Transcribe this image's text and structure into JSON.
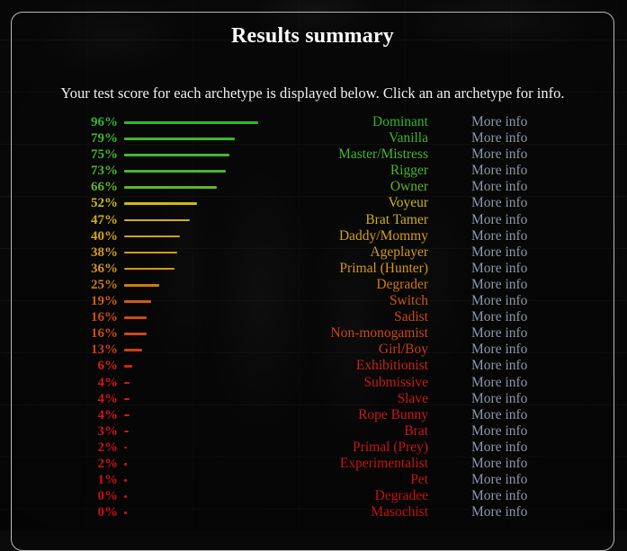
{
  "panel": {
    "title": "Results summary",
    "subtitle": "Your test score for each archetype is displayed below. Click an an archetype for info.",
    "more_info_label": "More info",
    "more_info_color": "#8d9aab",
    "border_color": "#b9b9b9",
    "title_color": "#ffffff"
  },
  "chart_data": {
    "type": "bar",
    "title": "Results summary",
    "xlabel": "",
    "ylabel": "",
    "xlim": [
      0,
      100
    ],
    "grid": false,
    "legend": null,
    "orientation": "horizontal",
    "value_suffix": "%",
    "categories": [
      "Dominant",
      "Vanilla",
      "Master/Mistress",
      "Rigger",
      "Owner",
      "Voyeur",
      "Brat Tamer",
      "Daddy/Mommy",
      "Ageplayer",
      "Primal (Hunter)",
      "Degrader",
      "Switch",
      "Sadist",
      "Non-monogamist",
      "Girl/Boy",
      "Exhibitionist",
      "Submissive",
      "Slave",
      "Rope Bunny",
      "Brat",
      "Primal (Prey)",
      "Experimentalist",
      "Pet",
      "Degradee",
      "Masochist"
    ],
    "values": [
      96,
      79,
      75,
      73,
      66,
      52,
      47,
      40,
      38,
      36,
      25,
      19,
      16,
      16,
      13,
      6,
      4,
      4,
      4,
      3,
      2,
      2,
      1,
      0,
      0
    ],
    "colors": [
      "#2db82d",
      "#3cb82a",
      "#46b828",
      "#4ab827",
      "#63b423",
      "#c9bb1c",
      "#cfb01a",
      "#d4a118",
      "#d59c17",
      "#d69817",
      "#cf7a14",
      "#ce5c16",
      "#cc4a16",
      "#cc4a16",
      "#cb3e16",
      "#cc2418",
      "#cc1a18",
      "#cc1a18",
      "#cc1a18",
      "#cc1818",
      "#cc1414",
      "#cc1414",
      "#cc1212",
      "#cc1010",
      "#cc1010"
    ]
  },
  "rows": [
    {
      "pct": "96%",
      "label": "Dominant",
      "value": 96,
      "color": "#2db82d"
    },
    {
      "pct": "79%",
      "label": "Vanilla",
      "value": 79,
      "color": "#3cb82a"
    },
    {
      "pct": "75%",
      "label": "Master/Mistress",
      "value": 75,
      "color": "#46b828"
    },
    {
      "pct": "73%",
      "label": "Rigger",
      "value": 73,
      "color": "#4ab827"
    },
    {
      "pct": "66%",
      "label": "Owner",
      "value": 66,
      "color": "#63b423"
    },
    {
      "pct": "52%",
      "label": "Voyeur",
      "value": 52,
      "color": "#c9bb1c"
    },
    {
      "pct": "47%",
      "label": "Brat Tamer",
      "value": 47,
      "color": "#cfb01a"
    },
    {
      "pct": "40%",
      "label": "Daddy/Mommy",
      "value": 40,
      "color": "#d4a118"
    },
    {
      "pct": "38%",
      "label": "Ageplayer",
      "value": 38,
      "color": "#d59c17"
    },
    {
      "pct": "36%",
      "label": "Primal (Hunter)",
      "value": 36,
      "color": "#d69817"
    },
    {
      "pct": "25%",
      "label": "Degrader",
      "value": 25,
      "color": "#cf7a14"
    },
    {
      "pct": "19%",
      "label": "Switch",
      "value": 19,
      "color": "#ce5c16"
    },
    {
      "pct": "16%",
      "label": "Sadist",
      "value": 16,
      "color": "#cc4a16"
    },
    {
      "pct": "16%",
      "label": "Non-monogamist",
      "value": 16,
      "color": "#cc4a16"
    },
    {
      "pct": "13%",
      "label": "Girl/Boy",
      "value": 13,
      "color": "#cb3e16"
    },
    {
      "pct": "6%",
      "label": "Exhibitionist",
      "value": 6,
      "color": "#cc2418"
    },
    {
      "pct": "4%",
      "label": "Submissive",
      "value": 4,
      "color": "#cc1a18"
    },
    {
      "pct": "4%",
      "label": "Slave",
      "value": 4,
      "color": "#cc1a18"
    },
    {
      "pct": "4%",
      "label": "Rope Bunny",
      "value": 4,
      "color": "#cc1a18"
    },
    {
      "pct": "3%",
      "label": "Brat",
      "value": 3,
      "color": "#cc1818"
    },
    {
      "pct": "2%",
      "label": "Primal (Prey)",
      "value": 2,
      "color": "#cc1414"
    },
    {
      "pct": "2%",
      "label": "Experimentalist",
      "value": 2,
      "color": "#cc1414"
    },
    {
      "pct": "1%",
      "label": "Pet",
      "value": 1,
      "color": "#cc1212"
    },
    {
      "pct": "0%",
      "label": "Degradee",
      "value": 0,
      "color": "#cc1010"
    },
    {
      "pct": "0%",
      "label": "Masochist",
      "value": 0,
      "color": "#cc1010"
    }
  ]
}
